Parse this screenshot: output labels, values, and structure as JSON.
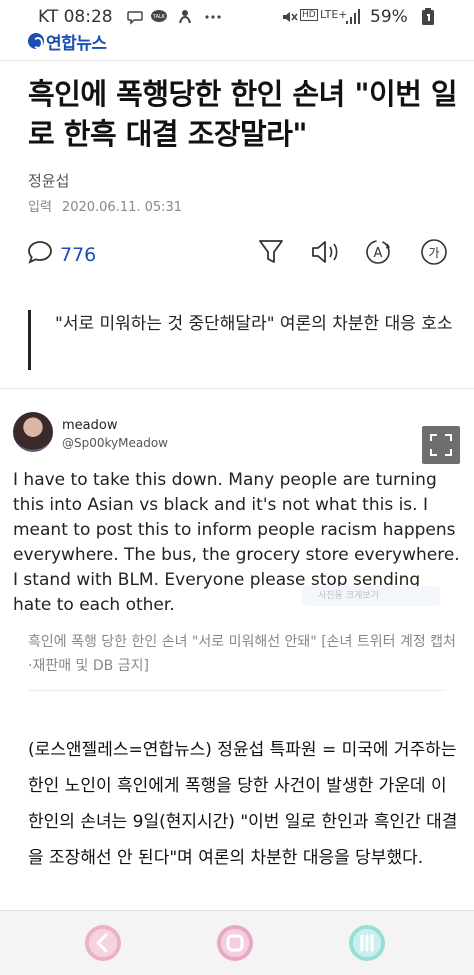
{
  "status": {
    "carrier_time": "KT 08:28",
    "battery": "59%",
    "icons": [
      "message-icon",
      "kakaotalk-icon",
      "notification-icon",
      "more-dots-icon",
      "mute-icon",
      "hd-icon",
      "lte-signal-icon",
      "battery-icon"
    ],
    "lte_label": "LTE+",
    "hd_label": "HD"
  },
  "header": {
    "logo_text": "연합뉴스"
  },
  "article": {
    "headline": "흑인에 폭행당한 한인 손녀 \"이번 일로 한흑 대결 조장말라\"",
    "author": "정윤섭",
    "date_label": "입력",
    "date": "2020.06.11. 05:31",
    "comment_count": "776",
    "subtitle": "\"서로 미워하는 것 중단해달라\" 여론의 차분한 대응 호소",
    "caption": "흑인에 폭행 당한 한인 손녀 \"서로 미워해선 안돼\" [손녀 트위터 계정 캡처·재판매 및 DB 금지]",
    "body": "(로스앤젤레스=연합뉴스) 정윤섭 특파원 = 미국에 거주하는 한인 노인이 흑인에게 폭행을 당한 사건이 발생한 가운데 이 한인의 손녀는 9일(현지시간) \"이번 일로 한인과 흑인간 대결을 조장해선 안 된다\"며 여론의 차분한 대응을 당부했다."
  },
  "toolbar": {
    "icons": [
      "comment-icon",
      "font-size-icon",
      "audio-icon",
      "translate-icon",
      "font-style-icon"
    ],
    "font_icon_label": "가",
    "translate_icon_label": "A"
  },
  "tweet": {
    "name": "meadow",
    "handle": "@Sp00kyMeadow",
    "text": "I have to take this down. Many people are turning this into Asian vs black and it's not what this is. I meant to post this to inform people racism happens everywhere. The bus, the grocery store everywhere. I stand with BLM. Everyone please stop sending hate to each other.",
    "ghost_label": "사진을 크게보기"
  },
  "nav": {
    "icons": [
      "back-icon",
      "home-icon",
      "recents-icon"
    ]
  },
  "colors": {
    "brand": "#1a4fb4",
    "text": "#111111",
    "muted": "#888888"
  }
}
